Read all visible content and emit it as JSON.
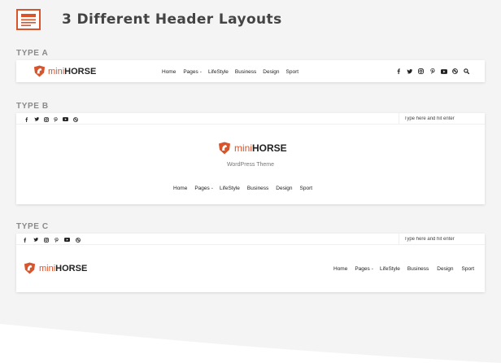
{
  "page": {
    "title": "3 Different Header Layouts"
  },
  "colors": {
    "accent": "#d9532b",
    "background": "#f4f4f4",
    "panel": "#ffffff"
  },
  "logo": {
    "mini": "mini",
    "horse": "HORSE",
    "icon": "horse-shield-icon"
  },
  "nav": {
    "items": [
      "Home",
      "Pages",
      "LifeStyle",
      "Business",
      "Design",
      "Sport"
    ],
    "dropdown_chevron": "⌄"
  },
  "social": {
    "icons": [
      "facebook-icon",
      "twitter-icon",
      "instagram-icon",
      "pinterest-icon",
      "youtube-icon",
      "dribbble-icon"
    ]
  },
  "search": {
    "placeholder": "Type here and hit enter"
  },
  "type_a": {
    "label": "TYPE A"
  },
  "type_b": {
    "label": "TYPE B",
    "tagline": "WordPress Theme"
  },
  "type_c": {
    "label": "TYPE C"
  }
}
